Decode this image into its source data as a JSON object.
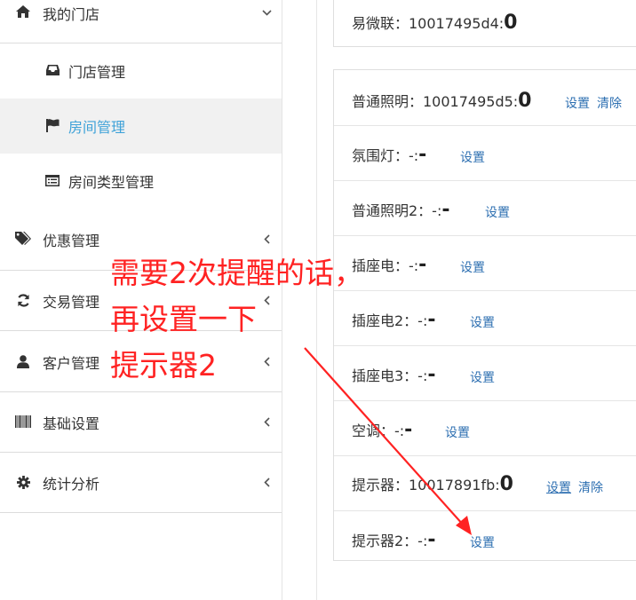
{
  "sidebar": {
    "my_store": {
      "label": "我的门店",
      "icon": "home-icon"
    },
    "sub_items": [
      {
        "label": "门店管理",
        "icon": "inbox-icon"
      },
      {
        "label": "房间管理",
        "icon": "flag-icon",
        "active": true
      },
      {
        "label": "房间类型管理",
        "icon": "list-icon"
      }
    ],
    "items": [
      {
        "label": "优惠管理",
        "icon": "tags-icon"
      },
      {
        "label": "交易管理",
        "icon": "refresh-icon"
      },
      {
        "label": "客户管理",
        "icon": "user-icon"
      },
      {
        "label": "基础设置",
        "icon": "barcode-icon"
      },
      {
        "label": "统计分析",
        "icon": "gear-icon"
      }
    ]
  },
  "top_panel": {
    "name": "易微联：10017495d4:",
    "value": "0"
  },
  "devices": [
    {
      "name": "普通照明：10017495d5:",
      "value": "0",
      "links": [
        "设置",
        "清除"
      ]
    },
    {
      "name": "氛围灯：-:",
      "value": "-",
      "links": [
        "设置"
      ]
    },
    {
      "name": "普通照明2：-:",
      "value": "-",
      "links": [
        "设置"
      ]
    },
    {
      "name": "插座电：-:",
      "value": "-",
      "links": [
        "设置"
      ]
    },
    {
      "name": "插座电2：-:",
      "value": "-",
      "links": [
        "设置"
      ]
    },
    {
      "name": "插座电3：-:",
      "value": "-",
      "links": [
        "设置"
      ]
    },
    {
      "name": "空调：-:",
      "value": "-",
      "links": [
        "设置"
      ]
    },
    {
      "name": "提示器：10017891fb:",
      "value": "0",
      "links": [
        "设置",
        "清除"
      ]
    },
    {
      "name": "提示器2：-:",
      "value": "-",
      "links": [
        "设置"
      ]
    }
  ],
  "annotation": {
    "lines": [
      "需要2次提醒的话，",
      "再设置一下",
      "提示器2"
    ],
    "color": "#ff2222"
  },
  "colors": {
    "link": "#2d6fb1",
    "active_text": "#3fa2d8",
    "active_bg": "#f1f1f1"
  }
}
